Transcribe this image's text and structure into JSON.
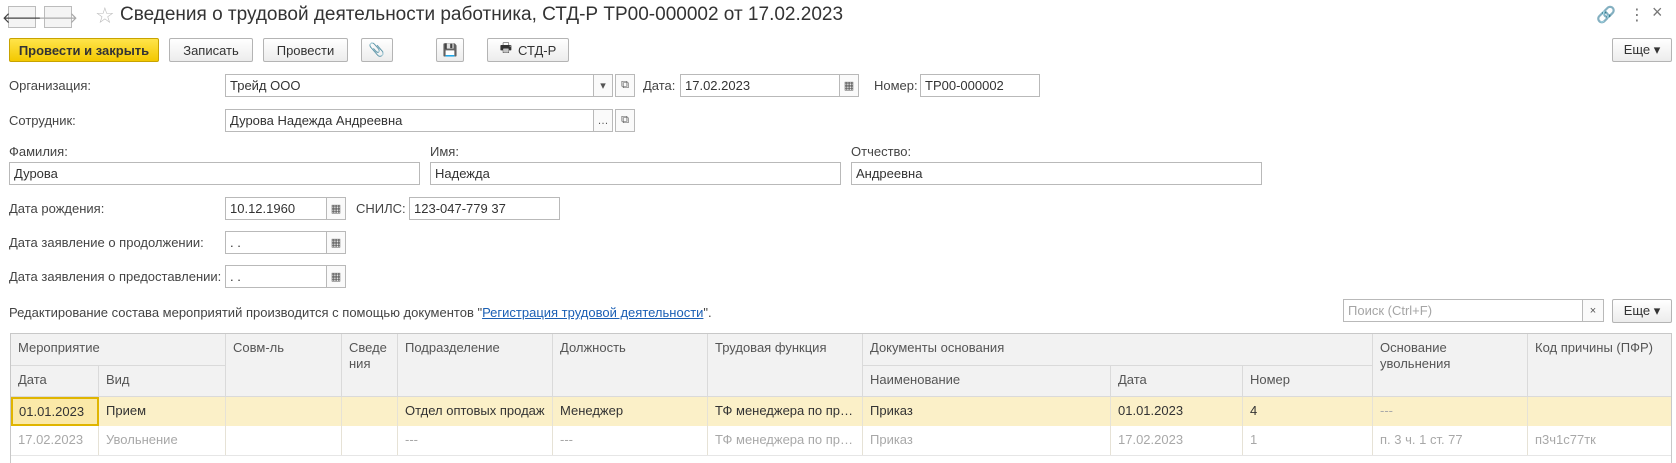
{
  "window": {
    "title": "Сведения о трудовой деятельности работника, СТД-Р ТР00-000002 от 17.02.2023",
    "back_icon": "arrow-left-icon",
    "forward_icon": "arrow-right-icon",
    "star_icon": "star-icon",
    "more_glyph": "⋮",
    "close_glyph": "×",
    "link_glyph": "🔗"
  },
  "toolbar": {
    "post_close": "Провести и закрыть",
    "save": "Записать",
    "post": "Провести",
    "attach_glyph": "📎",
    "disk_glyph": "💾",
    "print_glyph": "🖶",
    "std_r": "СТД-Р",
    "more": "Еще ▾"
  },
  "form": {
    "org_label": "Организация:",
    "org_value": "Трейд ООО",
    "date_label": "Дата:",
    "date_value": "17.02.2023",
    "number_label": "Номер:",
    "number_value": "ТР00-000002",
    "employee_label": "Сотрудник:",
    "employee_value": "Дурова Надежда Андреевна",
    "lastname_label": "Фамилия:",
    "lastname_value": "Дурова",
    "firstname_label": "Имя:",
    "firstname_value": "Надежда",
    "patronymic_label": "Отчество:",
    "patronymic_value": "Андреевна",
    "birth_label": "Дата рождения:",
    "birth_value": "10.12.1960",
    "snils_label": "СНИЛС:",
    "snils_value": "123-047-779 37",
    "cont_label": "Дата заявление о продолжении:",
    "cont_value": " .  .",
    "prov_label": "Дата заявления о предоставлении:",
    "prov_value": " .  ."
  },
  "info": {
    "text_before": "Редактирование состава мероприятий производится с помощью документов \"",
    "link": "Регистрация трудовой деятельности",
    "text_after": "\"."
  },
  "search": {
    "placeholder": "Поиск (Ctrl+F)",
    "clear": "×",
    "more": "Еще ▾"
  },
  "table": {
    "headers": {
      "event": "Мероприятие",
      "date": "Дата",
      "kind": "Вид",
      "combo": "Совм-ль",
      "info": "Сведения",
      "division": "Подразделение",
      "position": "Должность",
      "function": "Трудовая функция",
      "docs": "Документы основания",
      "doc_name": "Наименование",
      "doc_date": "Дата",
      "doc_number": "Номер",
      "reason": "Основание увольнения",
      "pfr_code": "Код причины (ПФР)"
    },
    "rows": [
      {
        "date": "01.01.2023",
        "kind": "Прием",
        "combo": "",
        "info": "",
        "division": "Отдел оптовых продаж",
        "position": "Менеджер",
        "function": "ТФ менеджера по продажам",
        "doc_name": "Приказ",
        "doc_date": "01.01.2023",
        "doc_number": "4",
        "reason": "---",
        "pfr_code": ""
      },
      {
        "date": "17.02.2023",
        "kind": "Увольнение",
        "combo": "",
        "info": "",
        "division": "---",
        "position": "---",
        "function": "ТФ менеджера по продажам",
        "doc_name": "Приказ",
        "doc_date": "17.02.2023",
        "doc_number": "1",
        "reason": "п. 3 ч. 1 ст. 77",
        "pfr_code": "п3ч1с77тк"
      }
    ]
  }
}
